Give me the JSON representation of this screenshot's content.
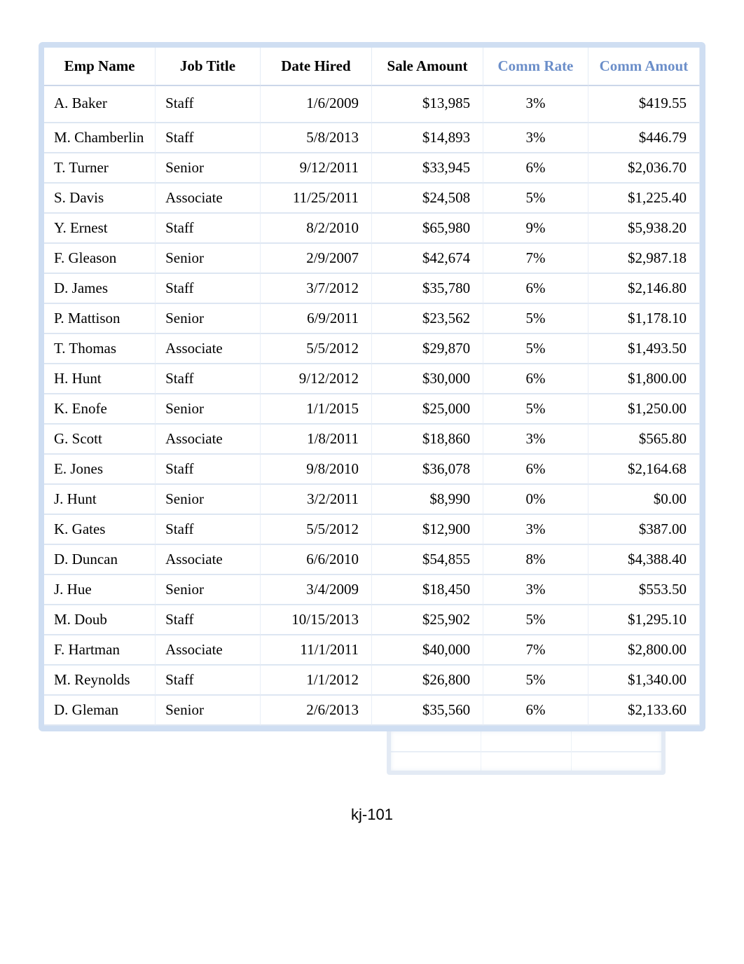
{
  "chart_data": {
    "type": "table",
    "columns": [
      "Emp Name",
      "Job Title",
      "Date Hired",
      "Sale Amount",
      "Comm Rate",
      "Comm Amout"
    ],
    "rows": [
      [
        "A. Baker",
        "Staff",
        "1/6/2009",
        13985,
        0.03,
        419.55
      ],
      [
        "M. Chamberlin",
        "Staff",
        "5/8/2013",
        14893,
        0.03,
        446.79
      ],
      [
        "T. Turner",
        "Senior",
        "9/12/2011",
        33945,
        0.06,
        2036.7
      ],
      [
        "S. Davis",
        "Associate",
        "11/25/2011",
        24508,
        0.05,
        1225.4
      ],
      [
        "Y. Ernest",
        "Staff",
        "8/2/2010",
        65980,
        0.09,
        5938.2
      ],
      [
        "F. Gleason",
        "Senior",
        "2/9/2007",
        42674,
        0.07,
        2987.18
      ],
      [
        "D. James",
        "Staff",
        "3/7/2012",
        35780,
        0.06,
        2146.8
      ],
      [
        "P. Mattison",
        "Senior",
        "6/9/2011",
        23562,
        0.05,
        1178.1
      ],
      [
        "T. Thomas",
        "Associate",
        "5/5/2012",
        29870,
        0.05,
        1493.5
      ],
      [
        "H. Hunt",
        "Staff",
        "9/12/2012",
        30000,
        0.06,
        1800.0
      ],
      [
        "K. Enofe",
        "Senior",
        "1/1/2015",
        25000,
        0.05,
        1250.0
      ],
      [
        "G. Scott",
        "Associate",
        "1/8/2011",
        18860,
        0.03,
        565.8
      ],
      [
        "E. Jones",
        "Staff",
        "9/8/2010",
        36078,
        0.06,
        2164.68
      ],
      [
        "J. Hunt",
        "Senior",
        "3/2/2011",
        8990,
        0.0,
        0.0
      ],
      [
        "K. Gates",
        "Staff",
        "5/5/2012",
        12900,
        0.03,
        387.0
      ],
      [
        "D. Duncan",
        "Associate",
        "6/6/2010",
        54855,
        0.08,
        4388.4
      ],
      [
        "J. Hue",
        "Senior",
        "3/4/2009",
        18450,
        0.03,
        553.5
      ],
      [
        "M. Doub",
        "Staff",
        "10/15/2013",
        25902,
        0.05,
        1295.1
      ],
      [
        "F. Hartman",
        "Associate",
        "11/1/2011",
        40000,
        0.07,
        2800.0
      ],
      [
        "M. Reynolds",
        "Staff",
        "1/1/2012",
        26800,
        0.05,
        1340.0
      ],
      [
        "D. Gleman",
        "Senior",
        "2/6/2013",
        35560,
        0.06,
        2133.6
      ]
    ]
  },
  "headers": {
    "emp_name": "Emp Name",
    "job_title": "Job Title",
    "date_hired": "Date Hired",
    "sale_amount": "Sale Amount",
    "comm_rate": "Comm Rate",
    "comm_amount": "Comm Amout"
  },
  "rows": [
    {
      "emp_name": "A. Baker",
      "job_title": "Staff",
      "date_hired": "1/6/2009",
      "sale_amount": "$13,985",
      "comm_rate": "3%",
      "comm_amount": "$419.55"
    },
    {
      "emp_name": "M. Chamberlin",
      "job_title": "Staff",
      "date_hired": "5/8/2013",
      "sale_amount": "$14,893",
      "comm_rate": "3%",
      "comm_amount": "$446.79"
    },
    {
      "emp_name": "T. Turner",
      "job_title": "Senior",
      "date_hired": "9/12/2011",
      "sale_amount": "$33,945",
      "comm_rate": "6%",
      "comm_amount": "$2,036.70"
    },
    {
      "emp_name": "S. Davis",
      "job_title": "Associate",
      "date_hired": "11/25/2011",
      "sale_amount": "$24,508",
      "comm_rate": "5%",
      "comm_amount": "$1,225.40"
    },
    {
      "emp_name": "Y. Ernest",
      "job_title": "Staff",
      "date_hired": "8/2/2010",
      "sale_amount": "$65,980",
      "comm_rate": "9%",
      "comm_amount": "$5,938.20"
    },
    {
      "emp_name": "F. Gleason",
      "job_title": "Senior",
      "date_hired": "2/9/2007",
      "sale_amount": "$42,674",
      "comm_rate": "7%",
      "comm_amount": "$2,987.18"
    },
    {
      "emp_name": "D. James",
      "job_title": "Staff",
      "date_hired": "3/7/2012",
      "sale_amount": "$35,780",
      "comm_rate": "6%",
      "comm_amount": "$2,146.80"
    },
    {
      "emp_name": "P. Mattison",
      "job_title": "Senior",
      "date_hired": "6/9/2011",
      "sale_amount": "$23,562",
      "comm_rate": "5%",
      "comm_amount": "$1,178.10"
    },
    {
      "emp_name": "T. Thomas",
      "job_title": "Associate",
      "date_hired": "5/5/2012",
      "sale_amount": "$29,870",
      "comm_rate": "5%",
      "comm_amount": "$1,493.50"
    },
    {
      "emp_name": "H. Hunt",
      "job_title": "Staff",
      "date_hired": "9/12/2012",
      "sale_amount": "$30,000",
      "comm_rate": "6%",
      "comm_amount": "$1,800.00"
    },
    {
      "emp_name": "K. Enofe",
      "job_title": "Senior",
      "date_hired": "1/1/2015",
      "sale_amount": "$25,000",
      "comm_rate": "5%",
      "comm_amount": "$1,250.00"
    },
    {
      "emp_name": "G. Scott",
      "job_title": "Associate",
      "date_hired": "1/8/2011",
      "sale_amount": "$18,860",
      "comm_rate": "3%",
      "comm_amount": "$565.80"
    },
    {
      "emp_name": "E. Jones",
      "job_title": "Staff",
      "date_hired": "9/8/2010",
      "sale_amount": "$36,078",
      "comm_rate": "6%",
      "comm_amount": "$2,164.68"
    },
    {
      "emp_name": "J. Hunt",
      "job_title": "Senior",
      "date_hired": "3/2/2011",
      "sale_amount": "$8,990",
      "comm_rate": "0%",
      "comm_amount": "$0.00"
    },
    {
      "emp_name": "K. Gates",
      "job_title": "Staff",
      "date_hired": "5/5/2012",
      "sale_amount": "$12,900",
      "comm_rate": "3%",
      "comm_amount": "$387.00"
    },
    {
      "emp_name": "D. Duncan",
      "job_title": "Associate",
      "date_hired": "6/6/2010",
      "sale_amount": "$54,855",
      "comm_rate": "8%",
      "comm_amount": "$4,388.40"
    },
    {
      "emp_name": "J. Hue",
      "job_title": "Senior",
      "date_hired": "3/4/2009",
      "sale_amount": "$18,450",
      "comm_rate": "3%",
      "comm_amount": "$553.50"
    },
    {
      "emp_name": "M. Doub",
      "job_title": "Staff",
      "date_hired": "10/15/2013",
      "sale_amount": "$25,902",
      "comm_rate": "5%",
      "comm_amount": "$1,295.10"
    },
    {
      "emp_name": "F. Hartman",
      "job_title": "Associate",
      "date_hired": "11/1/2011",
      "sale_amount": "$40,000",
      "comm_rate": "7%",
      "comm_amount": "$2,800.00"
    },
    {
      "emp_name": "M. Reynolds",
      "job_title": "Staff",
      "date_hired": "1/1/2012",
      "sale_amount": "$26,800",
      "comm_rate": "5%",
      "comm_amount": "$1,340.00"
    },
    {
      "emp_name": "D. Gleman",
      "job_title": "Senior",
      "date_hired": "2/6/2013",
      "sale_amount": "$35,560",
      "comm_rate": "6%",
      "comm_amount": "$2,133.60"
    }
  ],
  "footer": {
    "label": "kj-101"
  },
  "colors": {
    "calc_header": "#6b8ec9",
    "border_glow": "rgba(160,190,230,0.5)"
  }
}
